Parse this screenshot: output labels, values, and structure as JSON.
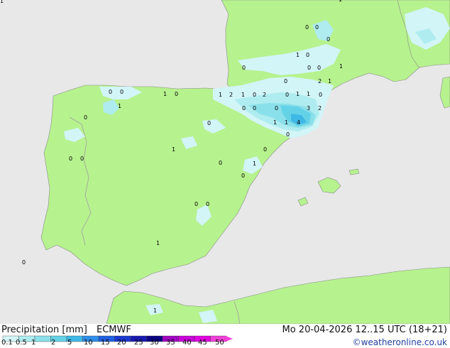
{
  "map": {
    "numbers": [
      "1",
      "1",
      "1",
      "1",
      "1",
      "1",
      "1",
      "1",
      "1",
      "1",
      "1",
      "1",
      "1",
      "1",
      "1",
      "1",
      "1",
      "2",
      "2",
      "2",
      "2",
      "3",
      "4",
      "0",
      "0",
      "0",
      "0",
      "0",
      "0",
      "0",
      "0",
      "0",
      "0",
      "0",
      "0",
      "0",
      "0",
      "0",
      "0",
      "0",
      "0",
      "0",
      "0",
      "0",
      "0",
      "0",
      "0",
      "0",
      "0",
      "0",
      "0"
    ]
  },
  "legend": {
    "title": "Precipitation [mm]",
    "model": "ECMWF",
    "valid_time": "Mo 20-04-2026 12..15 UTC (18+21)",
    "credit": "©weatheronline.co.uk",
    "ticks": [
      "0.1",
      "0.5",
      "1",
      "2",
      "5",
      "10",
      "15",
      "20",
      "25",
      "30",
      "35",
      "40",
      "45",
      "50"
    ],
    "colors": [
      "#d2f5f8",
      "#aeecf0",
      "#8ae0ea",
      "#64d2e6",
      "#3fb8e6",
      "#2e8fe8",
      "#2060e0",
      "#1a38d0",
      "#1a1ab0",
      "#0a0080",
      "#a000c0",
      "#c800d8",
      "#e000e0",
      "#f040d8"
    ]
  },
  "colors": {
    "land": "#b6f28e",
    "sea": "#e8e8e8",
    "border": "#a0a0a0",
    "coast": "#8a8a8a"
  }
}
